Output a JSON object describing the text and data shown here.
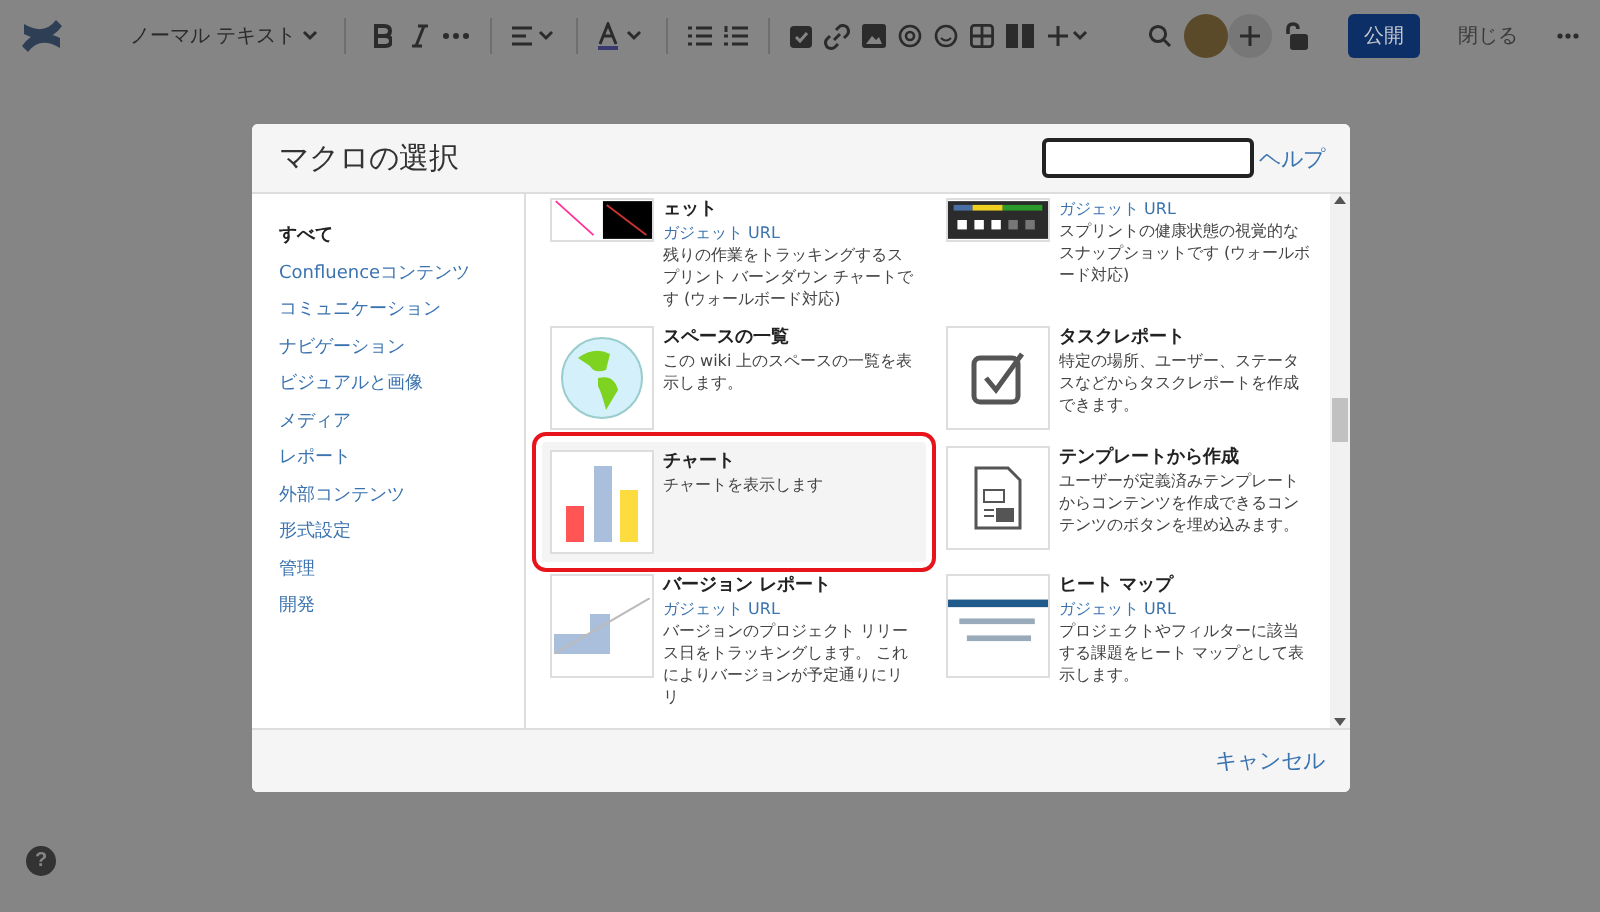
{
  "toolbar": {
    "text_style": "ノーマル テキスト",
    "publish": "公開",
    "close": "閉じる"
  },
  "dialog": {
    "title": "マクロの選択",
    "help_link": "ヘルプ",
    "categories": [
      {
        "label": "すべて",
        "selected": true
      },
      {
        "label": "Confluenceコンテンツ",
        "selected": false
      },
      {
        "label": "コミュニケーション",
        "selected": false
      },
      {
        "label": "ナビゲーション",
        "selected": false
      },
      {
        "label": "ビジュアルと画像",
        "selected": false
      },
      {
        "label": "メディア",
        "selected": false
      },
      {
        "label": "レポート",
        "selected": false
      },
      {
        "label": "外部コンテンツ",
        "selected": false
      },
      {
        "label": "形式設定",
        "selected": false
      },
      {
        "label": "管理",
        "selected": false
      },
      {
        "label": "開発",
        "selected": false
      }
    ],
    "macros": [
      {
        "kind": "burndown",
        "title": "ェット",
        "subtitle": "ガジェット URL",
        "description": "残りの作業をトラッキングするスプリント バーンダウン チャートです (ウォールボード対応)",
        "selected": false
      },
      {
        "kind": "sprint-health",
        "subtitle": "ガジェット URL",
        "description": "スプリントの健康状態の視覚的なスナップショットです (ウォールボード対応)",
        "selected": false
      },
      {
        "kind": "globe",
        "title": "スペースの一覧",
        "description": "この wiki 上のスペースの一覧を表示します。",
        "selected": false
      },
      {
        "kind": "checkbox",
        "title": "タスクレポート",
        "description": "特定の場所、ユーザー、ステータスなどからタスクレポートを作成できます。",
        "selected": false
      },
      {
        "kind": "bar-chart",
        "title": "チャート",
        "description": "チャートを表示します",
        "selected": true
      },
      {
        "kind": "template",
        "title": "テンプレートから作成",
        "description": "ユーザーが定義済みテンプレートからコンテンツを作成できるコンテンツのボタンを埋め込みます。",
        "selected": false
      },
      {
        "kind": "version",
        "title": "バージョン レポート",
        "subtitle": "ガジェット URL",
        "description": "バージョンのプロジェクト リリース日をトラッキングします。 これによりバージョンが予定通りにリリ",
        "selected": false
      },
      {
        "kind": "heatmap",
        "title": "ヒート マップ",
        "subtitle": "ガジェット URL",
        "description": "プロジェクトやフィルターに該当する課題をヒート マップとして表示します。",
        "selected": false
      }
    ],
    "cancel": "キャンセル"
  },
  "help_button": "?"
}
